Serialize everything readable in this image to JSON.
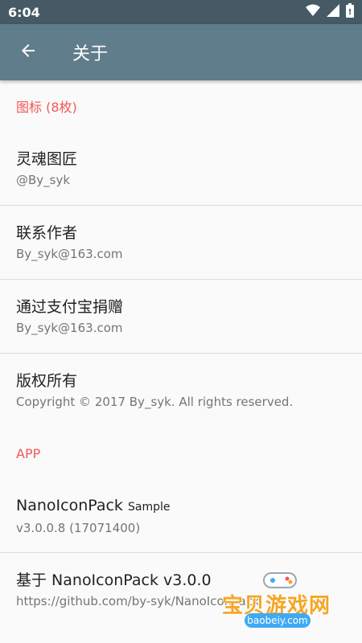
{
  "status_bar": {
    "time": "6:04"
  },
  "app_bar": {
    "title": "关于"
  },
  "sections": [
    {
      "header": "图标 (8枚)",
      "items": [
        {
          "title": "灵魂图匠",
          "subtitle": "@By_syk"
        },
        {
          "title": "联系作者",
          "subtitle": "By_syk@163.com"
        },
        {
          "title": "通过支付宝捐赠",
          "subtitle": "By_syk@163.com"
        },
        {
          "title": "版权所有",
          "subtitle": "Copyright © 2017 By_syk. All rights reserved."
        }
      ]
    },
    {
      "header": "APP",
      "items": [
        {
          "title": "NanoIconPack",
          "title_suffix": "Sample",
          "subtitle": "v3.0.0.8 (17071400)"
        },
        {
          "title": "基于 NanoIconPack v3.0.0",
          "subtitle": "https://github.com/by-syk/NanoIconPack"
        }
      ]
    }
  ],
  "watermark": {
    "text": "宝贝游戏网",
    "url": "baobeiy.com"
  },
  "colors": {
    "status_bar": "#455a64",
    "app_bar": "#607d8b",
    "accent": "#f25757"
  }
}
